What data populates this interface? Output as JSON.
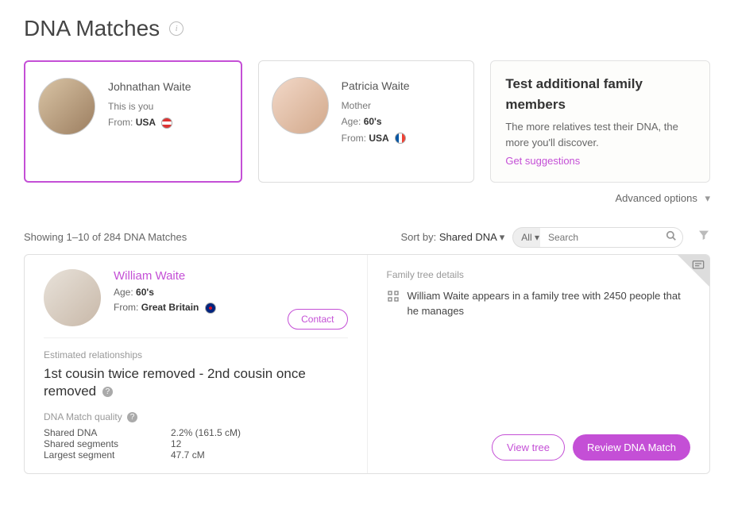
{
  "page": {
    "title": "DNA Matches"
  },
  "profiles": [
    {
      "name": "Johnathan Waite",
      "subtitle": "This is you",
      "from_label": "From:",
      "from_value": "USA"
    },
    {
      "name": "Patricia Waite",
      "subtitle": "Mother",
      "age_label": "Age:",
      "age_value": "60's",
      "from_label": "From:",
      "from_value": "USA"
    }
  ],
  "promo": {
    "title": "Test additional family members",
    "body": "The more relatives test their DNA, the more you'll discover.",
    "link": "Get suggestions"
  },
  "advanced_options": "Advanced options",
  "listing": {
    "count_text": "Showing 1–10 of 284 DNA Matches",
    "sort_label": "Sort by:",
    "sort_value": "Shared DNA",
    "filter_dropdown": "All",
    "search_placeholder": "Search"
  },
  "match": {
    "name": "William Waite",
    "age_label": "Age:",
    "age_value": "60's",
    "from_label": "From:",
    "from_value": "Great Britain",
    "contact": "Contact",
    "est_rel_label": "Estimated relationships",
    "relationship": "1st cousin twice removed - 2nd cousin once removed",
    "quality_label": "DNA Match quality",
    "shared_dna_label": "Shared DNA",
    "shared_dna_value": "2.2% (161.5 cM)",
    "segments_label": "Shared segments",
    "segments_value": "12",
    "largest_label": "Largest segment",
    "largest_value": "47.7 cM",
    "tree_label": "Family tree details",
    "tree_text": "William Waite appears in a family tree with 2450 people that he manages",
    "view_tree": "View tree",
    "review": "Review DNA Match"
  }
}
